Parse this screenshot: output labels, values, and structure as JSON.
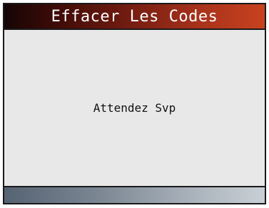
{
  "header": {
    "title": "Effacer Les Codes"
  },
  "main": {
    "message": "Attendez Svp"
  }
}
